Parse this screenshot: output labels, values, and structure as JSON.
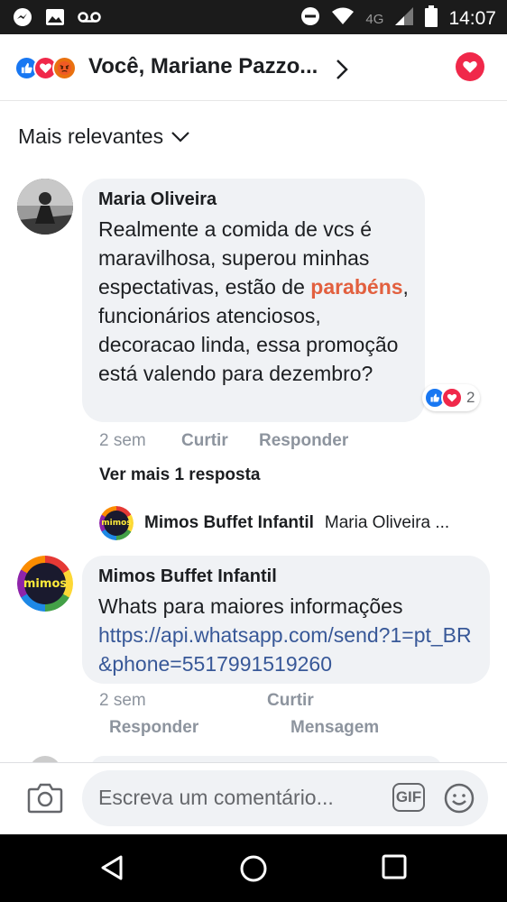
{
  "status_bar": {
    "network": "4G",
    "time": "14:07",
    "icons": [
      "messenger-icon",
      "gallery-icon",
      "voicemail-icon",
      "dnd-icon",
      "wifi-icon",
      "signal-icon",
      "battery-icon"
    ]
  },
  "header": {
    "reactions": [
      "like",
      "love",
      "angry"
    ],
    "title": "Você, Mariane Pazzo...",
    "colors": {
      "like": "#1877f2",
      "love": "#f0284a",
      "angry": "#e9710f"
    }
  },
  "sort": {
    "label": "Mais relevantes"
  },
  "comments": [
    {
      "author": "Maria Oliveira",
      "text_before": "Realmente a comida de vcs é maravilhosa, superou minhas espectativas, estão de",
      "hashtag": "parabéns",
      "text_after": ", funcionários atenciosos, decoracao linda, essa promoção está valendo para dezembro?",
      "reaction_count": "2",
      "time": "2 sem",
      "like_label": "Curtir",
      "reply_label": "Responder",
      "more_replies": "Ver mais 1 resposta",
      "reply_preview": {
        "author": "Mimos Buffet Infantil",
        "text": "Maria Oliveira ..."
      }
    },
    {
      "author": "Mimos Buffet Infantil",
      "text": "Whats para maiores informações",
      "link": "https://api.whatsapp.com/send?1=pt_BR&phone=5517991519260",
      "time": "2 sem",
      "like_label": "Curtir",
      "reply_label": "Responder",
      "message_label": "Mensagem"
    }
  ],
  "composer": {
    "placeholder": "Escreva um comentário...",
    "gif_label": "GIF"
  }
}
